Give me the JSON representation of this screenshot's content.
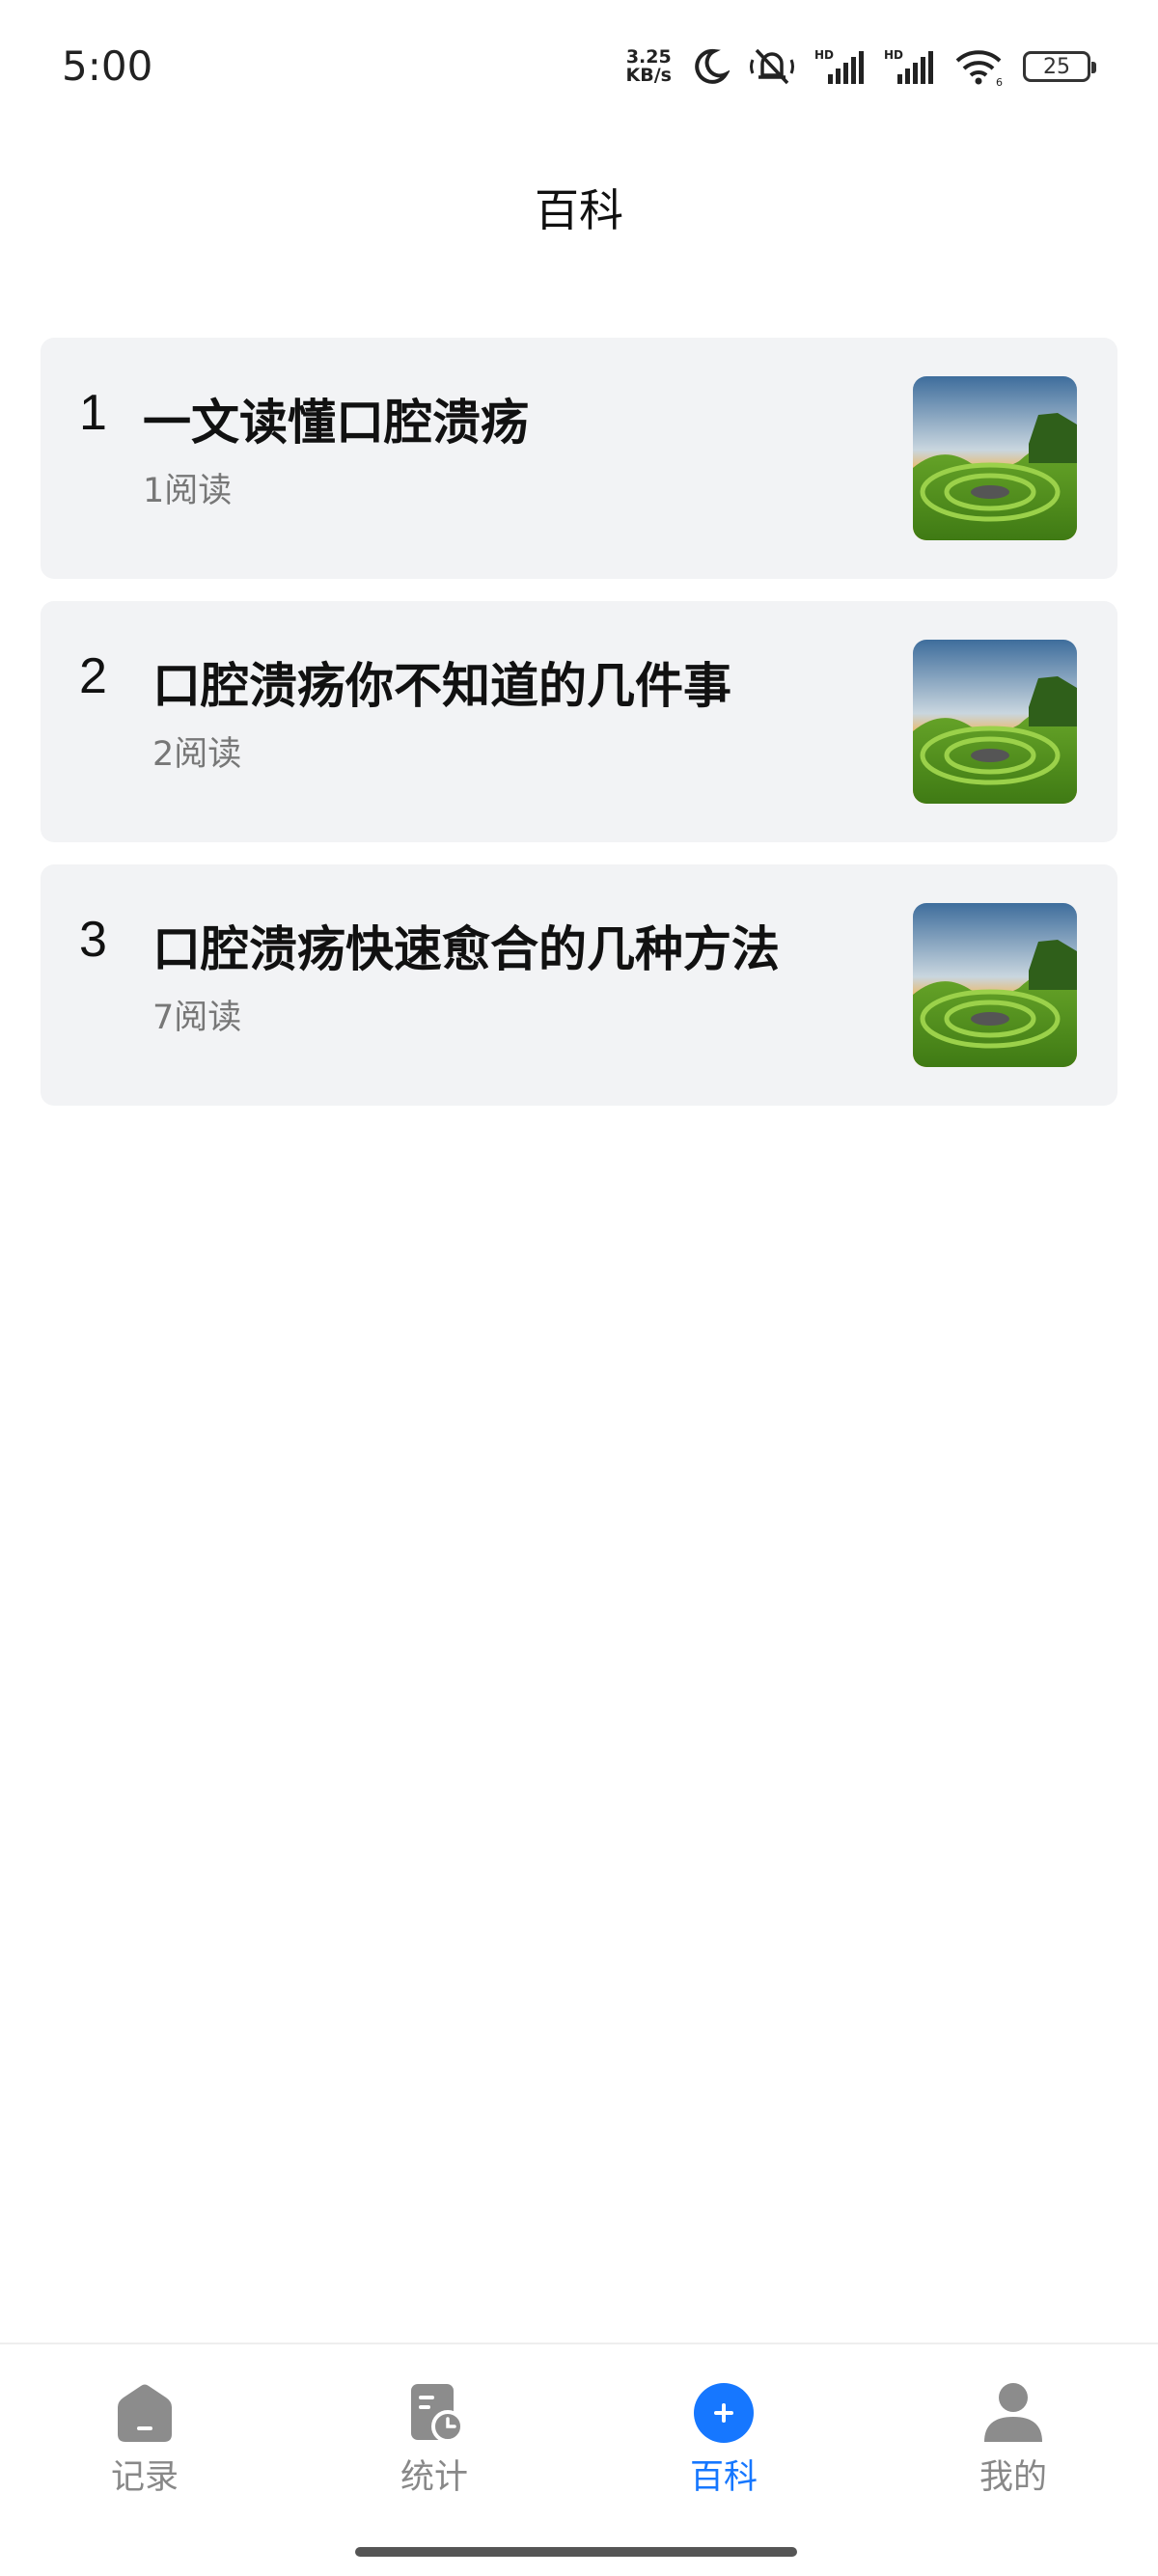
{
  "status_bar": {
    "time": "5:00",
    "net_speed_value": "3.25",
    "net_speed_unit": "KB/s",
    "battery": "25",
    "icons": [
      "moon-icon",
      "mute-icon",
      "signal-hd-icon",
      "signal-hd-icon",
      "wifi-icon",
      "battery-icon"
    ]
  },
  "header": {
    "title": "百科"
  },
  "articles": [
    {
      "index": "1",
      "title": "一文读懂口腔溃疡",
      "reads": "1阅读"
    },
    {
      "index": "2",
      "title": "口腔溃疡你不知道的几件事",
      "reads": "2阅读"
    },
    {
      "index": "3",
      "title": "口腔溃疡快速愈合的几种方法",
      "reads": "7阅读"
    }
  ],
  "tabs": [
    {
      "label": "记录",
      "icon": "house-icon",
      "active": false
    },
    {
      "label": "统计",
      "icon": "stats-clock-icon",
      "active": false
    },
    {
      "label": "百科",
      "icon": "plus-circle-icon",
      "active": true
    },
    {
      "label": "我的",
      "icon": "user-icon",
      "active": false
    }
  ],
  "colors": {
    "accent": "#1677ff",
    "card_bg": "#f2f3f5",
    "inactive_tab": "#888888"
  }
}
